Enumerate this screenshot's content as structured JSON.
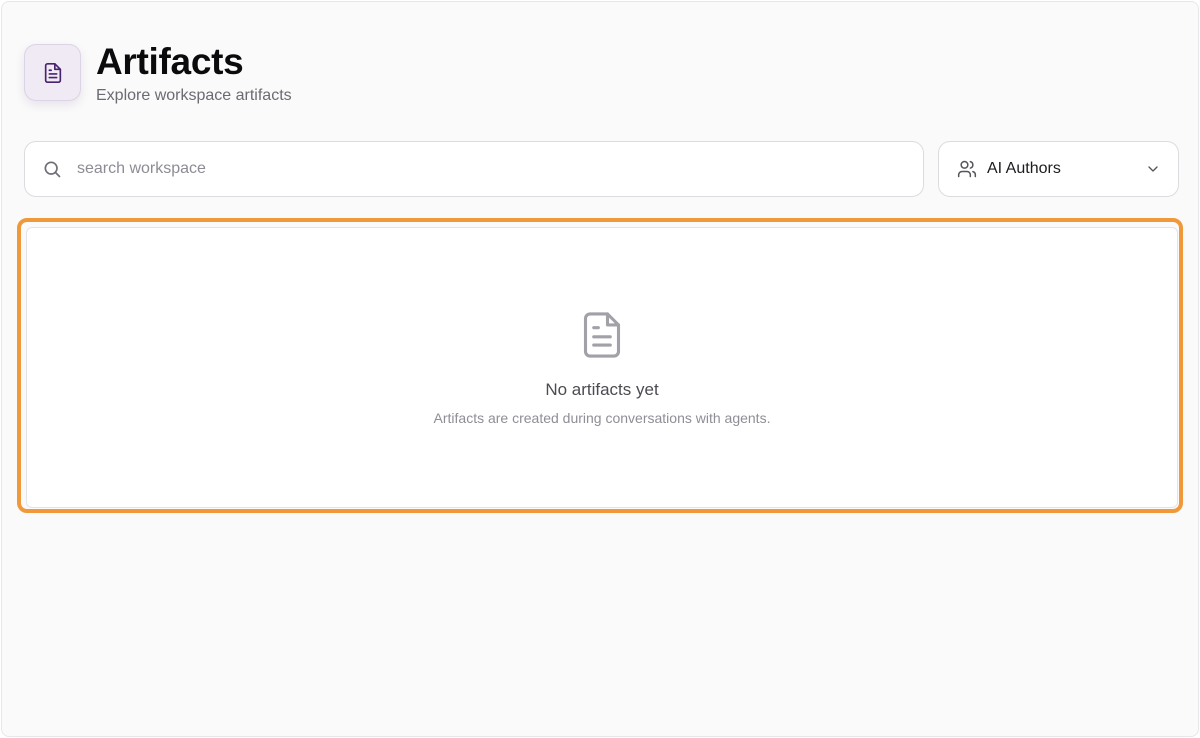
{
  "header": {
    "icon": "document-icon",
    "title": "Artifacts",
    "subtitle": "Explore workspace artifacts"
  },
  "search": {
    "icon": "search-icon",
    "placeholder": "search workspace",
    "value": ""
  },
  "author_filter": {
    "icon": "users-icon",
    "selected": "AI Authors",
    "chevron": "chevron-down-icon"
  },
  "empty_state": {
    "icon": "document-icon",
    "title": "No artifacts yet",
    "description": "Artifacts are created during conversations with agents."
  },
  "colors": {
    "accent": "#5b2a86",
    "highlight": "#f0993a",
    "header_icon_bg": "#efeaf3"
  }
}
